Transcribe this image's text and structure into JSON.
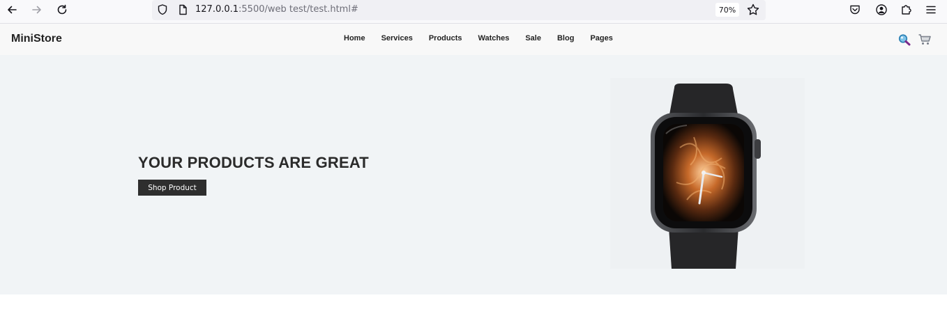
{
  "browser": {
    "url_host": "127.0.0.1",
    "url_rest": ":5500/web test/test.html#",
    "zoom": "70%"
  },
  "site": {
    "brand": "MiniStore",
    "nav": [
      {
        "label": "Home"
      },
      {
        "label": "Services"
      },
      {
        "label": "Products"
      },
      {
        "label": "Watches"
      },
      {
        "label": "Sale"
      },
      {
        "label": "Blog"
      },
      {
        "label": "Pages"
      }
    ],
    "icons": {
      "search": "search-icon",
      "cart": "cart-icon"
    }
  },
  "hero": {
    "title": "YOUR PRODUCTS ARE GREAT",
    "button_label": "Shop Product",
    "image": "smartwatch-image"
  },
  "colors": {
    "hero_bg": "#f1f4f6",
    "button_bg": "#2e2e2e",
    "header_bg": "#f8f8f8"
  }
}
